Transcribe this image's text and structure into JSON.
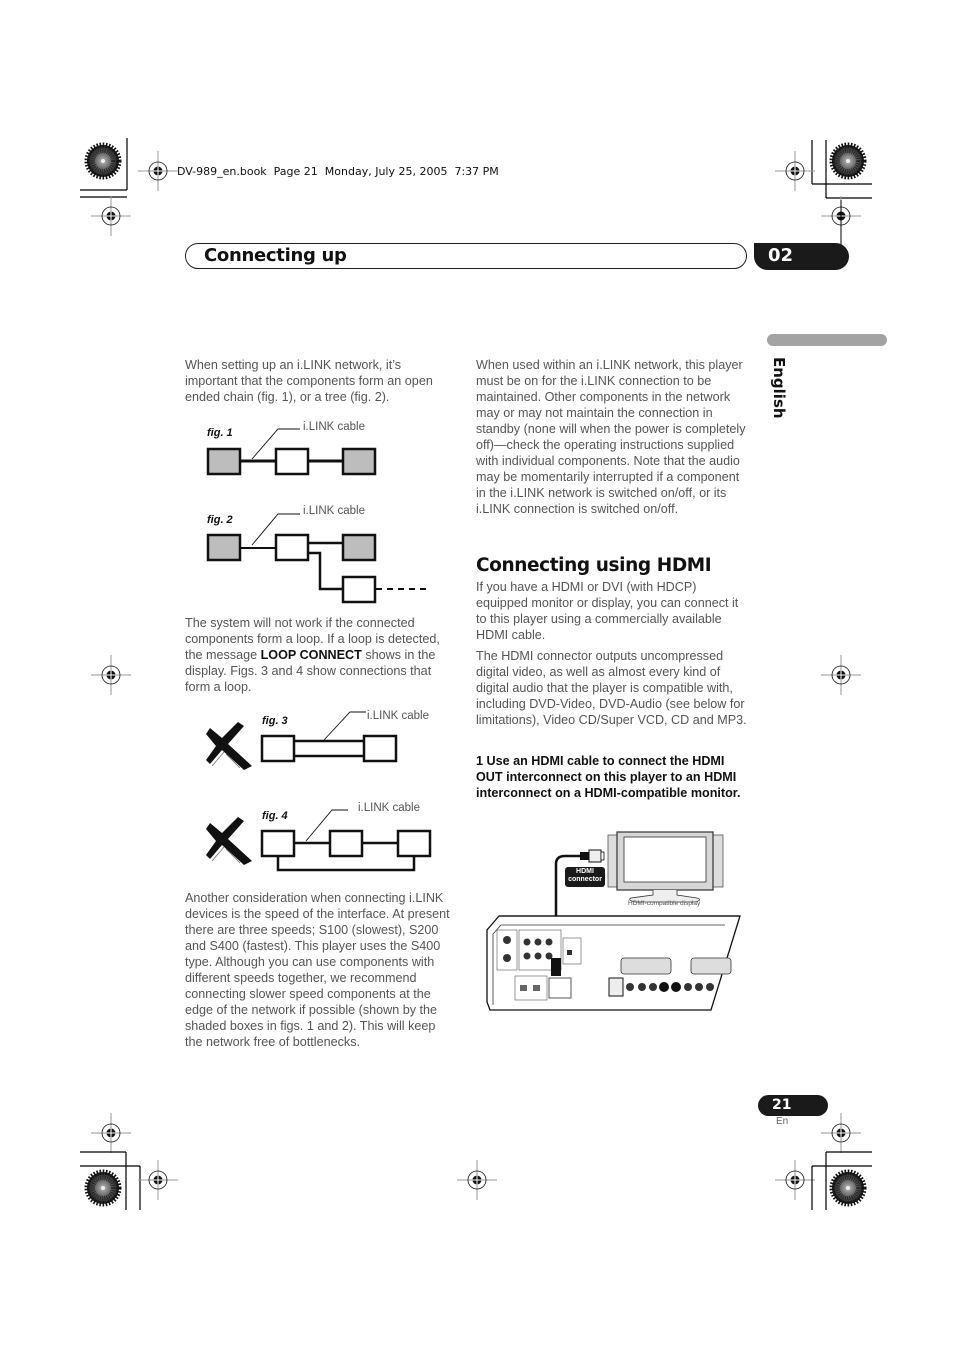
{
  "slug": "DV-989_en.book  Page 21  Monday, July 25, 2005  7:37 PM",
  "header": {
    "title": "Connecting up",
    "chapter": "02"
  },
  "sidebar": {
    "language": "English"
  },
  "left_column": {
    "intro": "When setting up an i.LINK network, it’s important that the components form an open ended chain (fig. 1), or a tree (fig. 2).",
    "loop_text_before": "The system will not work if the connected components form a loop. If a loop is detected, the message ",
    "loop_message": "LOOP CONNECT",
    "loop_text_after": " shows in the display. Figs. 3 and 4 show connections that form a loop.",
    "speed_text": "Another consideration when connecting i.LINK devices is the speed of the interface. At present there are three speeds; S100 (slowest), S200 and S400 (fastest). This player uses the S400 type. Although you can use components with different speeds together, we recommend connecting slower speed components at the edge of the network if possible (shown by the shaded boxes in figs. 1 and 2). This will keep the network free of bottlenecks."
  },
  "figures": {
    "fig1": {
      "label": "fig. 1",
      "cable_label": "i.LINK cable"
    },
    "fig2": {
      "label": "fig. 2",
      "cable_label": "i.LINK cable"
    },
    "fig3": {
      "label": "fig. 3",
      "cable_label": "i.LINK cable"
    },
    "fig4": {
      "label": "fig. 4",
      "cable_label": "i.LINK cable"
    }
  },
  "right_column": {
    "standby_text": "When used within an i.LINK network, this player must be on for the i.LINK connection to be maintained. Other components in the network may or may not maintain the connection in standby (none will when the power is completely off)—check the operating instructions supplied with individual components. Note that the audio may be momentarily interrupted if a component in the i.LINK network is switched on/off, or its i.LINK connection is switched on/off.",
    "hdmi_heading": "Connecting using HDMI",
    "hdmi_p1": "If you have a HDMI or DVI (with HDCP) equipped monitor or display, you can connect it to this player using a commercially available HDMI cable.",
    "hdmi_p2": "The HDMI connector outputs uncompressed digital video, as well as almost every kind of digital audio that the player is compatible with, including DVD-Video, DVD-Audio (see below for limitations), Video CD/Super VCD, CD and MP3.",
    "step1": "1    Use an HDMI cable to connect the HDMI OUT interconnect on this player to an HDMI interconnect on a HDMI-compatible monitor."
  },
  "hdmi_illustration": {
    "connector_label_line1": "HDMI",
    "connector_label_line2": "connector",
    "display_label": "HDMI-compatible display"
  },
  "footer": {
    "page_number": "21",
    "language_code": "En"
  }
}
